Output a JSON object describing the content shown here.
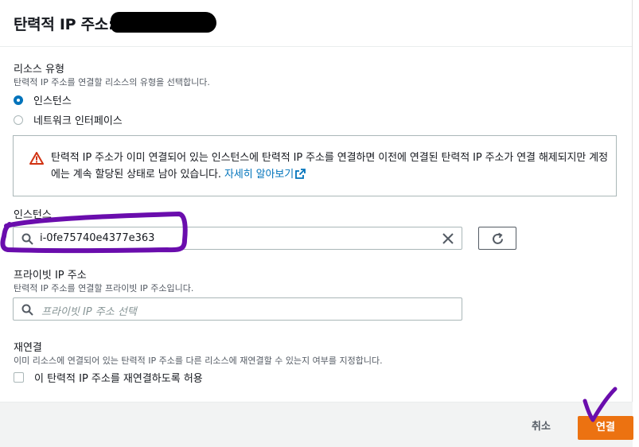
{
  "modal": {
    "title": "탄력적 IP 주소:"
  },
  "resource_type": {
    "label": "리소스 유형",
    "description": "탄력적 IP 주소를 연결할 리소스의 유형을 선택합니다.",
    "options": [
      {
        "label": "인스턴스",
        "selected": true
      },
      {
        "label": "네트워크 인터페이스",
        "selected": false
      }
    ]
  },
  "alert": {
    "text": "탄력적 IP 주소가 이미 연결되어 있는 인스턴스에 탄력적 IP 주소를 연결하면 이전에 연결된 탄력적 IP 주소가 연결 해제되지만 계정에는 계속 할당된 상태로 남아 있습니다. ",
    "link": "자세히 알아보기",
    "icon": "warning-icon",
    "color": "#d13212"
  },
  "instance": {
    "label": "인스턴스",
    "value": "i-0fe75740e4377e363"
  },
  "private_ip": {
    "label": "프라이빗 IP 주소",
    "description": "탄력적 IP 주소를 연결할 프라이빗 IP 주소입니다.",
    "placeholder": "프라이빗 IP 주소 선택"
  },
  "reassociate": {
    "label": "재연결",
    "description": "이미 리소스에 연결되어 있는 탄력적 IP 주소를 다른 리소스에 재연결할 수 있는지 여부를 지정합니다.",
    "checkbox_label": "이 탄력적 IP 주소를 재연결하도록 허용",
    "checked": false
  },
  "footer": {
    "cancel_label": "취소",
    "connect_label": "연결",
    "primary_color": "#ec7211"
  },
  "annotation_color": "#6a0dad"
}
